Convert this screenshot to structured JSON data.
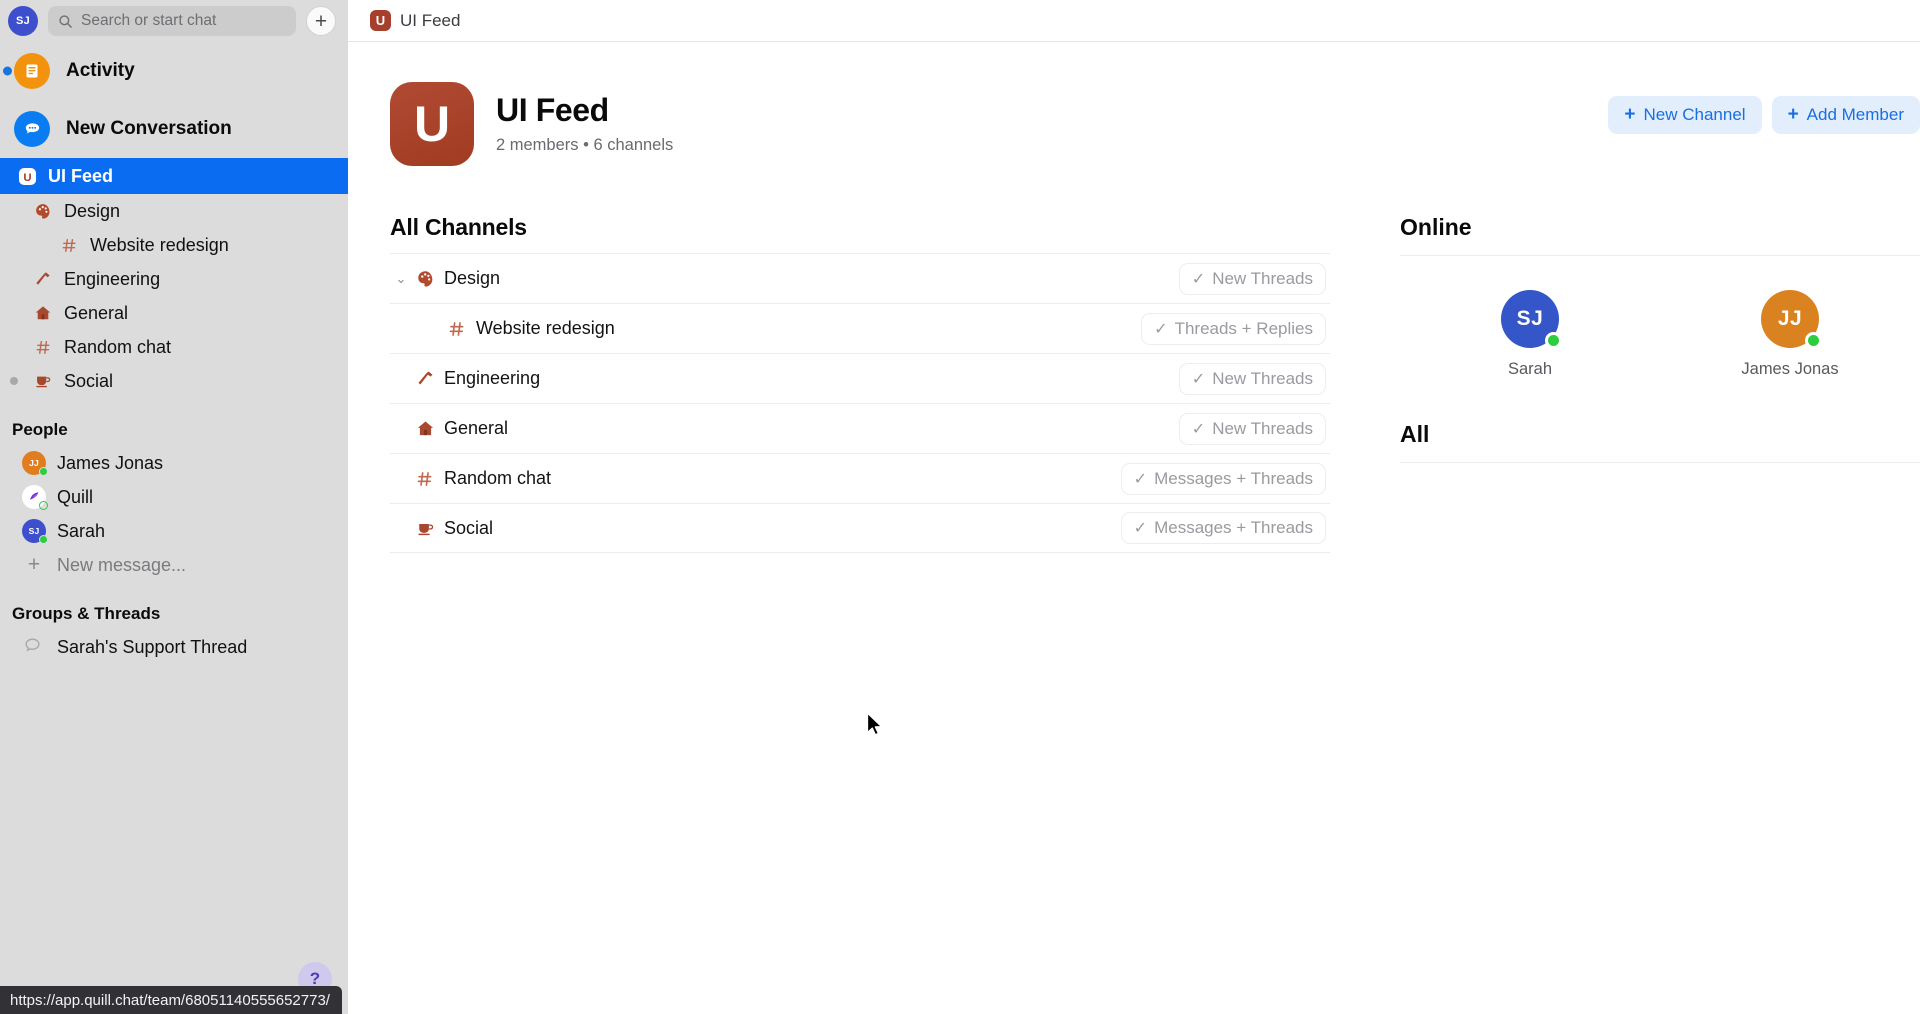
{
  "sidebar": {
    "account_avatar": {
      "initials": "SJ",
      "color": "#3d4fcc"
    },
    "search": {
      "placeholder": "Search or start chat",
      "icon": "search-icon"
    },
    "new_button_label": "+",
    "primary": [
      {
        "label": "Activity",
        "icon": "activity-icon",
        "color": "#f3930d",
        "unread": true
      },
      {
        "label": "New Conversation",
        "icon": "chat-bubble-icon",
        "color": "#0a7cf1",
        "unread": false
      }
    ],
    "team": {
      "label": "UI Feed",
      "icon": "ui-feed-logo",
      "active": true
    },
    "channels": [
      {
        "label": "Design",
        "icon": "palette-icon",
        "indent": false,
        "unread": false
      },
      {
        "label": "Website redesign",
        "icon": "hash-icon",
        "indent": true,
        "unread": false
      },
      {
        "label": "Engineering",
        "icon": "hammer-icon",
        "indent": false,
        "unread": false
      },
      {
        "label": "General",
        "icon": "house-icon",
        "indent": false,
        "unread": false
      },
      {
        "label": "Random chat",
        "icon": "hash-icon",
        "indent": false,
        "unread": false
      },
      {
        "label": "Social",
        "icon": "coffee-icon",
        "indent": false,
        "unread": true
      }
    ],
    "people_heading": "People",
    "people": [
      {
        "name": "James Jonas",
        "initials": "JJ",
        "color": "#e07d1e",
        "status": "online"
      },
      {
        "name": "Quill",
        "initials": "Q",
        "color": "#ffffff",
        "status": "away"
      },
      {
        "name": "Sarah",
        "initials": "SJ",
        "color": "#3d4fcc",
        "status": "online"
      }
    ],
    "new_message_label": "New message...",
    "groups_heading": "Groups & Threads",
    "groups": [
      {
        "label": "Sarah's Support Thread",
        "icon": "speech-bubble-icon"
      }
    ]
  },
  "topbar": {
    "badge_letter": "U",
    "title": "UI Feed",
    "settings_icon": "gear-icon",
    "accent": "#1a73e8"
  },
  "header": {
    "logo_letter": "U",
    "name": "UI Feed",
    "meta": "2 members • 6 channels",
    "actions": [
      {
        "label": "New Channel",
        "plus": "+"
      },
      {
        "label": "Add Member",
        "plus": "+"
      }
    ]
  },
  "channels_panel": {
    "title": "All Channels",
    "rows": [
      {
        "name": "Design",
        "icon": "palette-icon",
        "chevron": "⌄",
        "sub": false,
        "badge": "New Threads",
        "check": "✓"
      },
      {
        "name": "Website redesign",
        "icon": "hash-icon",
        "chevron": "",
        "sub": true,
        "badge": "Threads + Replies",
        "check": "✓"
      },
      {
        "name": "Engineering",
        "icon": "hammer-icon",
        "chevron": "",
        "sub": false,
        "badge": "New Threads",
        "check": "✓"
      },
      {
        "name": "General",
        "icon": "house-icon",
        "chevron": "",
        "sub": false,
        "badge": "New Threads",
        "check": "✓"
      },
      {
        "name": "Random chat",
        "icon": "hash-icon",
        "chevron": "",
        "sub": false,
        "badge": "Messages + Threads",
        "check": "✓"
      },
      {
        "name": "Social",
        "icon": "coffee-icon",
        "chevron": "",
        "sub": false,
        "badge": "Messages + Threads",
        "check": "✓"
      }
    ]
  },
  "members_panel": {
    "online_title": "Online",
    "all_title": "All",
    "online": [
      {
        "name": "Sarah",
        "initials": "SJ",
        "color": "#3456c8",
        "status": "online"
      },
      {
        "name": "James Jonas",
        "initials": "JJ",
        "color": "#d9821f",
        "status": "online"
      }
    ]
  },
  "help_button": {
    "label": "?",
    "color": "#cfc9ee"
  },
  "status_bar": {
    "url": "https://app.quill.chat/team/68051140555652773/"
  }
}
